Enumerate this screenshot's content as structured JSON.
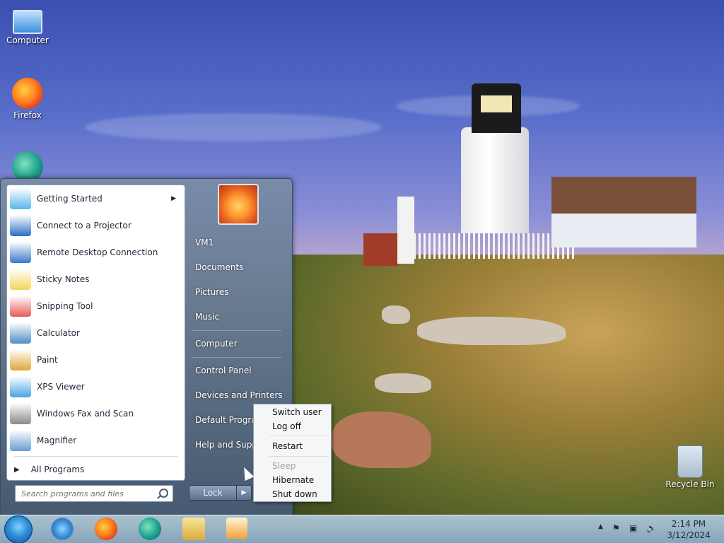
{
  "desktop": {
    "icons": [
      {
        "label": "Computer"
      },
      {
        "label": "Firefox"
      },
      {
        "label": ""
      }
    ],
    "recycle_bin": {
      "label": "Recycle Bin"
    }
  },
  "start_menu": {
    "programs": [
      {
        "label": "Getting Started",
        "icon": "getting-started-icon",
        "has_submenu": true
      },
      {
        "label": "Connect to a Projector",
        "icon": "projector-icon"
      },
      {
        "label": "Remote Desktop Connection",
        "icon": "remote-desktop-icon"
      },
      {
        "label": "Sticky Notes",
        "icon": "sticky-notes-icon"
      },
      {
        "label": "Snipping Tool",
        "icon": "snipping-tool-icon"
      },
      {
        "label": "Calculator",
        "icon": "calculator-icon"
      },
      {
        "label": "Paint",
        "icon": "paint-icon"
      },
      {
        "label": "XPS Viewer",
        "icon": "xps-viewer-icon"
      },
      {
        "label": "Windows Fax and Scan",
        "icon": "fax-scan-icon"
      },
      {
        "label": "Magnifier",
        "icon": "magnifier-icon"
      }
    ],
    "all_programs": "All Programs",
    "search": {
      "placeholder": "Search programs and files"
    },
    "right_links": [
      {
        "label": "VM1"
      },
      {
        "label": "Documents"
      },
      {
        "label": "Pictures"
      },
      {
        "label": "Music"
      },
      {
        "label": "Computer"
      },
      {
        "label": "Control Panel"
      },
      {
        "label": "Devices and Printers"
      },
      {
        "label": "Default Programs"
      },
      {
        "label": "Help and Support"
      }
    ],
    "power_button": {
      "label": "Lock"
    },
    "power_menu": [
      {
        "label": "Switch user",
        "enabled": true
      },
      {
        "label": "Log off",
        "enabled": true
      },
      {
        "label": "Restart",
        "enabled": true
      },
      {
        "label": "Sleep",
        "enabled": false
      },
      {
        "label": "Hibernate",
        "enabled": true
      },
      {
        "label": "Shut down",
        "enabled": true
      }
    ]
  },
  "taskbar": {
    "pinned": [
      "internet-explorer-icon",
      "firefox-icon",
      "edge-icon",
      "file-explorer-icon",
      "media-player-icon"
    ],
    "clock": {
      "time": "2:14 PM",
      "date": "3/12/2024"
    }
  }
}
